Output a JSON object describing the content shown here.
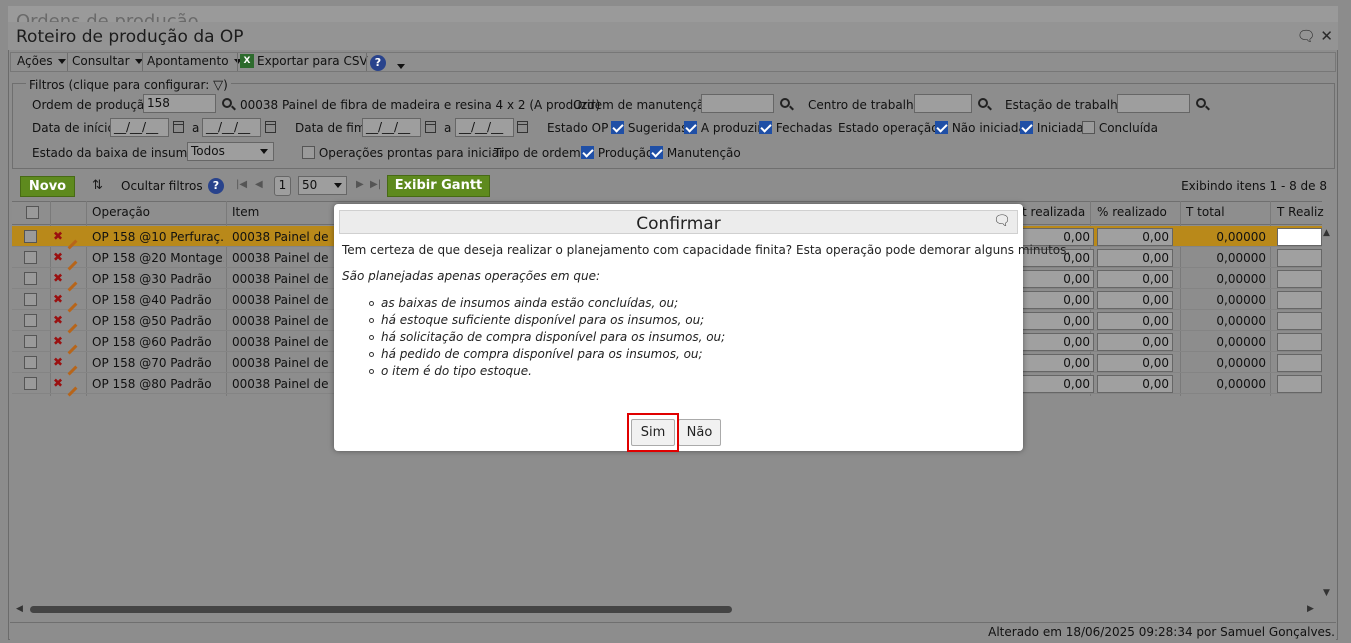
{
  "outer": {
    "title": "Ordens de produção"
  },
  "window": {
    "title": "Roteiro de produção da OP"
  },
  "menu": {
    "acoes": "Ações",
    "consultar": "Consultar",
    "apontamento": "Apontamento",
    "exportar": "Exportar para CSV"
  },
  "filters": {
    "legend": "Filtros (clique para configurar:",
    "ordem_producao_label": "Ordem de produção",
    "ordem_producao_value": "158",
    "ordem_producao_desc": "00038 Painel de fibra de madeira e resina 4 x 2 (A produzir)",
    "ordem_manutencao_label": "Ordem de manutenção",
    "centro_trabalho_label": "Centro de trabalho",
    "estacao_trabalho_label": "Estação de trabalho",
    "data_inicio_label": "Data de início",
    "data_fim_label": "Data de fim",
    "date_placeholder": "__/__/__",
    "a_label": "a",
    "estado_op_label": "Estado OP",
    "sugeridas": "Sugeridas",
    "a_produzir": "A produzir",
    "fechadas": "Fechadas",
    "estado_operacao_label": "Estado operação",
    "nao_iniciada": "Não iniciada",
    "iniciada": "Iniciada",
    "concluida": "Concluída",
    "estado_baixa_label": "Estado da baixa de insumos",
    "estado_baixa_value": "Todos",
    "operacoes_prontas": "Operações prontas para iniciar",
    "tipo_ordem_label": "Tipo de ordem",
    "producao": "Produção",
    "manutencao": "Manutenção"
  },
  "toolbar": {
    "novo": "Novo",
    "ocultar_filtros": "Ocultar filtros",
    "page": "1",
    "page_size": "50",
    "exibir_gantt": "Exibir Gantt",
    "exibindo": "Exibindo itens 1 - 8 de 8"
  },
  "grid": {
    "headers": {
      "operacao": "Operação",
      "item": "Item",
      "t_realizada": "t realizada",
      "pct_realizado": "% realizado",
      "t_total": "T total",
      "t_realiz": "T Realiz"
    },
    "rows": [
      {
        "operacao": "OP 158 @10 Perfuraç...",
        "item": "00038 Painel de fib",
        "t_realizada": "0,00",
        "pct": "0,00",
        "t_total": "0,00000"
      },
      {
        "operacao": "OP 158 @20 Montage...",
        "item": "00038 Painel de fib",
        "t_realizada": "0,00",
        "pct": "0,00",
        "t_total": "0,00000"
      },
      {
        "operacao": "OP 158 @30 Padrão",
        "item": "00038 Painel de fib",
        "t_realizada": "0,00",
        "pct": "0,00",
        "t_total": "0,00000"
      },
      {
        "operacao": "OP 158 @40 Padrão",
        "item": "00038 Painel de fib",
        "t_realizada": "0,00",
        "pct": "0,00",
        "t_total": "0,00000"
      },
      {
        "operacao": "OP 158 @50 Padrão",
        "item": "00038 Painel de fib",
        "t_realizada": "0,00",
        "pct": "0,00",
        "t_total": "0,00000"
      },
      {
        "operacao": "OP 158 @60 Padrão",
        "item": "00038 Painel de fib",
        "t_realizada": "0,00",
        "pct": "0,00",
        "t_total": "0,00000"
      },
      {
        "operacao": "OP 158 @70 Padrão",
        "item": "00038 Painel de fib",
        "t_realizada": "0,00",
        "pct": "0,00",
        "t_total": "0,00000"
      },
      {
        "operacao": "OP 158 @80 Padrão",
        "item": "00038 Painel de fib",
        "t_realizada": "0,00",
        "pct": "0,00",
        "t_total": "0,00000"
      }
    ]
  },
  "status": {
    "text": "Alterado em 18/06/2025 09:28:34 por Samuel Gonçalves."
  },
  "modal": {
    "title": "Confirmar",
    "question": "Tem certeza de que deseja realizar o planejamento com capacidade finita? Esta operação pode demorar alguns minutos.",
    "intro": "São planejadas apenas operações em que:",
    "bullets": [
      "as baixas de insumos ainda estão concluídas, ou;",
      "há estoque suficiente disponível para os insumos, ou;",
      "há solicitação de compra disponível para os insumos, ou;",
      "há pedido de compra disponível para os insumos, ou;",
      "o item é do tipo estoque."
    ],
    "sim": "Sim",
    "nao": "Não"
  }
}
